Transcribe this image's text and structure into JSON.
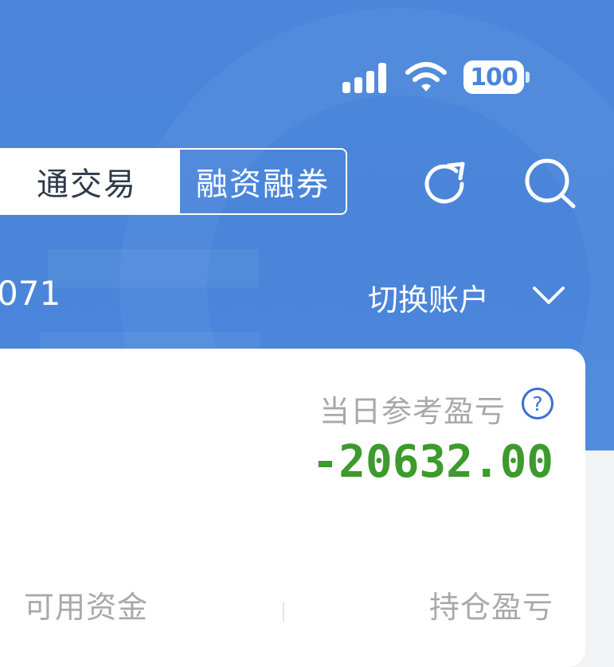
{
  "status_bar": {
    "battery": "100",
    "signal_icon": "signal-icon",
    "wifi_icon": "wifi-icon"
  },
  "tabs": {
    "normal_trading": "通交易",
    "margin_trading": "融资融券"
  },
  "toolbar": {
    "refresh_icon": "refresh-icon",
    "search_icon": "search-icon"
  },
  "account": {
    "number": "071",
    "switch_label": "切换账户",
    "switch_icon": "chevron-down-icon"
  },
  "summary": {
    "daily_pnl_label": "当日参考盈亏",
    "daily_pnl_value": "-20632.00",
    "help_icon": "help-icon",
    "available_funds_label": "可用资金",
    "position_pnl_label": "持仓盈亏"
  },
  "colors": {
    "header_blue": "#4a85da",
    "loss_green": "#3d9a2c",
    "label_gray": "#a8a8ad"
  }
}
